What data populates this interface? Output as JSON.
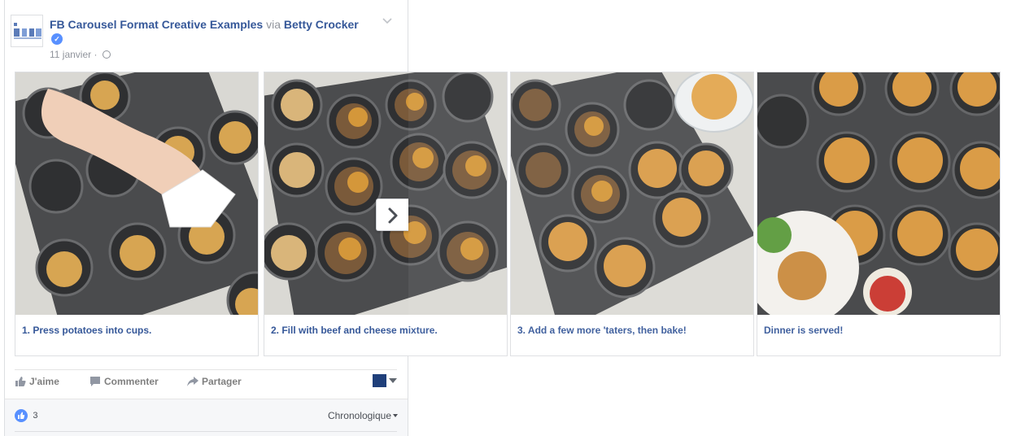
{
  "post": {
    "page_name": "FB Carousel Format Creative Examples",
    "via_label": "via",
    "shared_from": "Betty Crocker",
    "date": "11 janvier",
    "separator": "·",
    "privacy_icon": "globe-icon",
    "verified_icon": "verified-badge-icon"
  },
  "carousel": {
    "cards": [
      {
        "caption": "1. Press potatoes into cups.",
        "image": "muffin tin with hand pressing potatoes"
      },
      {
        "caption": "2. Fill with beef and cheese mixture.",
        "image": "muffin tin filled with beef and cheese"
      },
      {
        "caption": "3. Add a few more 'taters, then bake!",
        "image": "muffin tin with tater tots and bowl"
      },
      {
        "caption": "Dinner is served!",
        "image": "baked tater tot cups with salad"
      }
    ],
    "next_icon": "chevron-right-icon"
  },
  "actions": {
    "like": "J'aime",
    "comment": "Commenter",
    "share": "Partager"
  },
  "footer": {
    "reaction_count": "3",
    "sort_label": "Chronologique"
  },
  "colors": {
    "link": "#365899",
    "muted": "#90949c",
    "accent": "#5890ff"
  }
}
